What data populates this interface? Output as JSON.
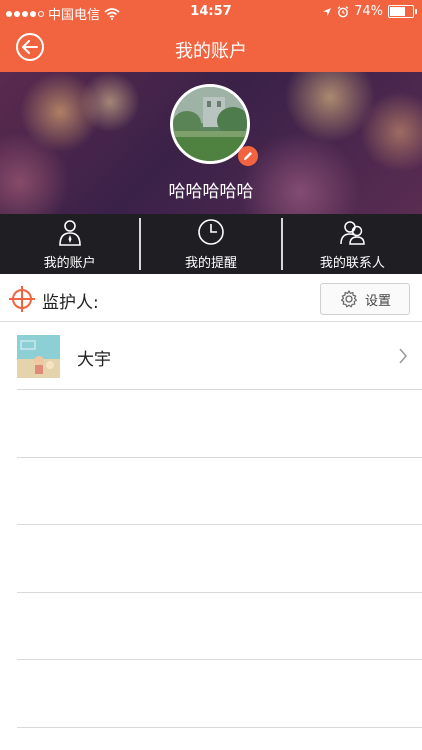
{
  "status_bar": {
    "carrier": "中国电信",
    "time": "14:57",
    "battery": "74%",
    "battery_level": 0.74,
    "signal_bars_filled": 4,
    "signal_bars_total": 5
  },
  "nav": {
    "title": "我的账户",
    "back_icon": "back-arrow-icon"
  },
  "profile": {
    "user_name": "哈哈哈哈哈",
    "edit_icon": "pencil-icon"
  },
  "tabs": [
    {
      "label": "我的账户",
      "icon": "person-icon"
    },
    {
      "label": "我的提醒",
      "icon": "clock-icon"
    },
    {
      "label": "我的联系人",
      "icon": "contacts-icon"
    }
  ],
  "guardian": {
    "label": "监护人:",
    "icon": "crosshair-icon",
    "settings_label": "设置",
    "settings_icon": "gear-icon"
  },
  "contacts": [
    {
      "name": "大宇"
    }
  ],
  "colors": {
    "accent": "#f26440",
    "tab_bar": "#1f1e22",
    "divider": "#d9d9d9"
  }
}
